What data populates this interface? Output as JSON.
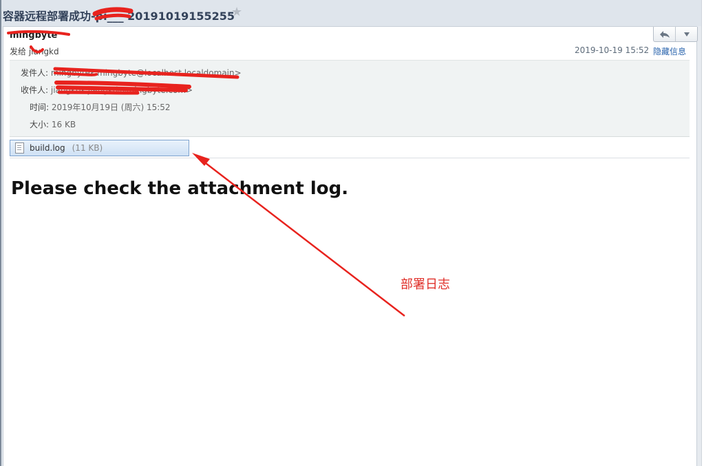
{
  "email": {
    "subject": "容器远程部署成功-pi___ 20191019155255",
    "sender_name": "mingbyte",
    "recipient_summary": "发给 jiangkd",
    "date_short": "2019-10-19 15:52",
    "hide_details_label": "隐藏信息",
    "details": {
      "from_label": "发件人:",
      "from_value": "mingbyte<mingbyte@localhost.localdomain>",
      "to_label": "收件人:",
      "to_value": "jiangkd<jiangkd@mingbyte.com>",
      "time_label": "时间:",
      "time_value": "2019年10月19日 (周六) 15:52",
      "size_label": "大小:",
      "size_value": "16 KB"
    },
    "attachment": {
      "name": "build.log",
      "size": "(11 KB)"
    },
    "body": "Please check the attachment log."
  },
  "toolbar": {
    "reply_icon": "reply-arrow-icon",
    "more_icon": "dropdown-triangle-icon"
  },
  "annotation": {
    "text": "部署日志",
    "color": "#e0302a"
  },
  "colors": {
    "accent_link": "#2a64ad",
    "redaction": "#e8231e",
    "attachment_border": "#7da2ce"
  }
}
